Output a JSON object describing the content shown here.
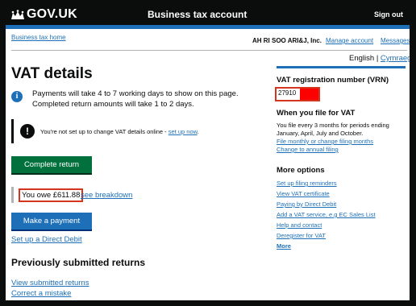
{
  "header": {
    "logo": "GOV.UK",
    "service": "Business tax account",
    "sign_out": "Sign out"
  },
  "breadcrumb": "Business tax home",
  "account_name": "AH RI SOO ARI&J, Inc.",
  "account_links": {
    "manage": "Manage account",
    "messages": "Messages"
  },
  "language": {
    "english": "English",
    "separator": "|",
    "welsh": "Cymraeg"
  },
  "main": {
    "title": "VAT details",
    "info_line1": "Payments will take 4 to 7 working days to show on this page.",
    "info_line2": "Completed return amounts will take 1 to 2 days.",
    "warning_text": "You're not set up to change VAT details online - ",
    "warning_link": "set up now",
    "warning_end": ".",
    "complete_return": "Complete return",
    "owe": "You owe £611.88",
    "breakdown": "see breakdown",
    "make_payment": "Make a payment",
    "direct_debit": "Set up a Direct Debit",
    "previous_heading": "Previously submitted returns",
    "view_returns": "View submitted returns",
    "correct_mistake": "Correct a mistake"
  },
  "sidebar": {
    "vrn_heading": "VAT registration number (VRN)",
    "vrn_value": "27910",
    "file_heading": "When you file for VAT",
    "file_text": "You file every 3 months for periods ending January, April, July and October.",
    "file_link1": "File monthly or change filing months",
    "file_link2": "Change to annual filing",
    "more_heading": "More options",
    "more_links": [
      "Set up filing reminders",
      "View VAT certificate",
      "Paying by Direct Debit",
      "Add a VAT service, e.g EC Sales List",
      "Help and contact",
      "Deregister for VAT",
      "More"
    ]
  },
  "colors": {
    "link": "#1d70b8",
    "button_green": "#00703c",
    "header": "#0b0c0c",
    "highlight": "#d4351c"
  }
}
